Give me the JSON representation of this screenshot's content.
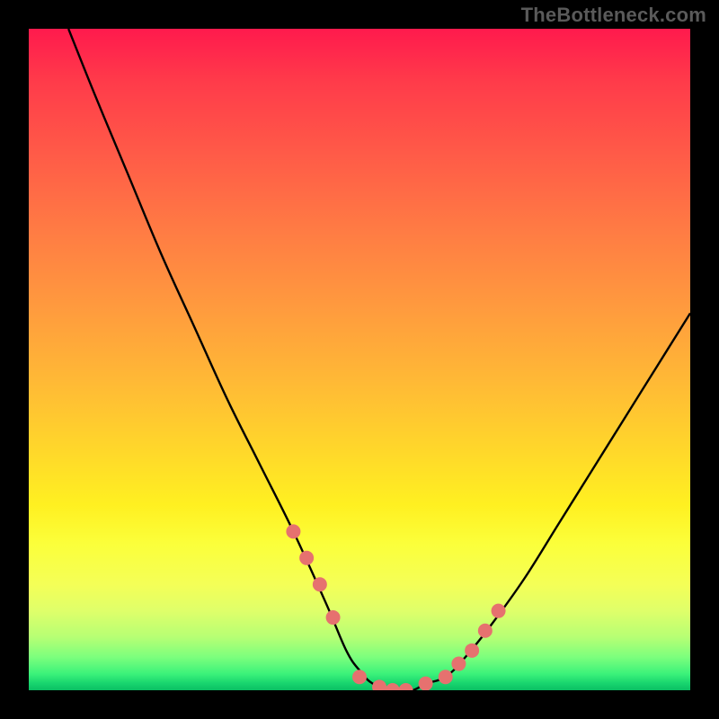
{
  "watermark": "TheBottleneck.com",
  "colors": {
    "page_bg": "#000000",
    "curve": "#000000",
    "marker": "#e6716f",
    "gradient_top": "#ff1a4d",
    "gradient_bottom": "#0bbf63"
  },
  "chart_data": {
    "type": "line",
    "title": "",
    "xlabel": "",
    "ylabel": "",
    "xlim": [
      0,
      100
    ],
    "ylim": [
      0,
      100
    ],
    "grid": false,
    "legend": false,
    "series": [
      {
        "name": "bottleneck-curve",
        "x": [
          6,
          10,
          15,
          20,
          25,
          30,
          35,
          40,
          45,
          48,
          50,
          52,
          55,
          58,
          60,
          63,
          66,
          70,
          75,
          80,
          85,
          90,
          95,
          100
        ],
        "values": [
          100,
          90,
          78,
          66,
          55,
          44,
          34,
          24,
          13,
          6,
          3,
          1,
          0,
          0,
          1,
          2,
          5,
          10,
          17,
          25,
          33,
          41,
          49,
          57
        ]
      }
    ],
    "markers": {
      "name": "highlight-dots",
      "x": [
        40,
        42,
        44,
        46,
        50,
        53,
        55,
        57,
        60,
        63,
        65,
        67,
        69,
        71
      ],
      "values": [
        24,
        20,
        16,
        11,
        2,
        0.5,
        0,
        0,
        1,
        2,
        4,
        6,
        9,
        12
      ]
    },
    "annotations": []
  }
}
